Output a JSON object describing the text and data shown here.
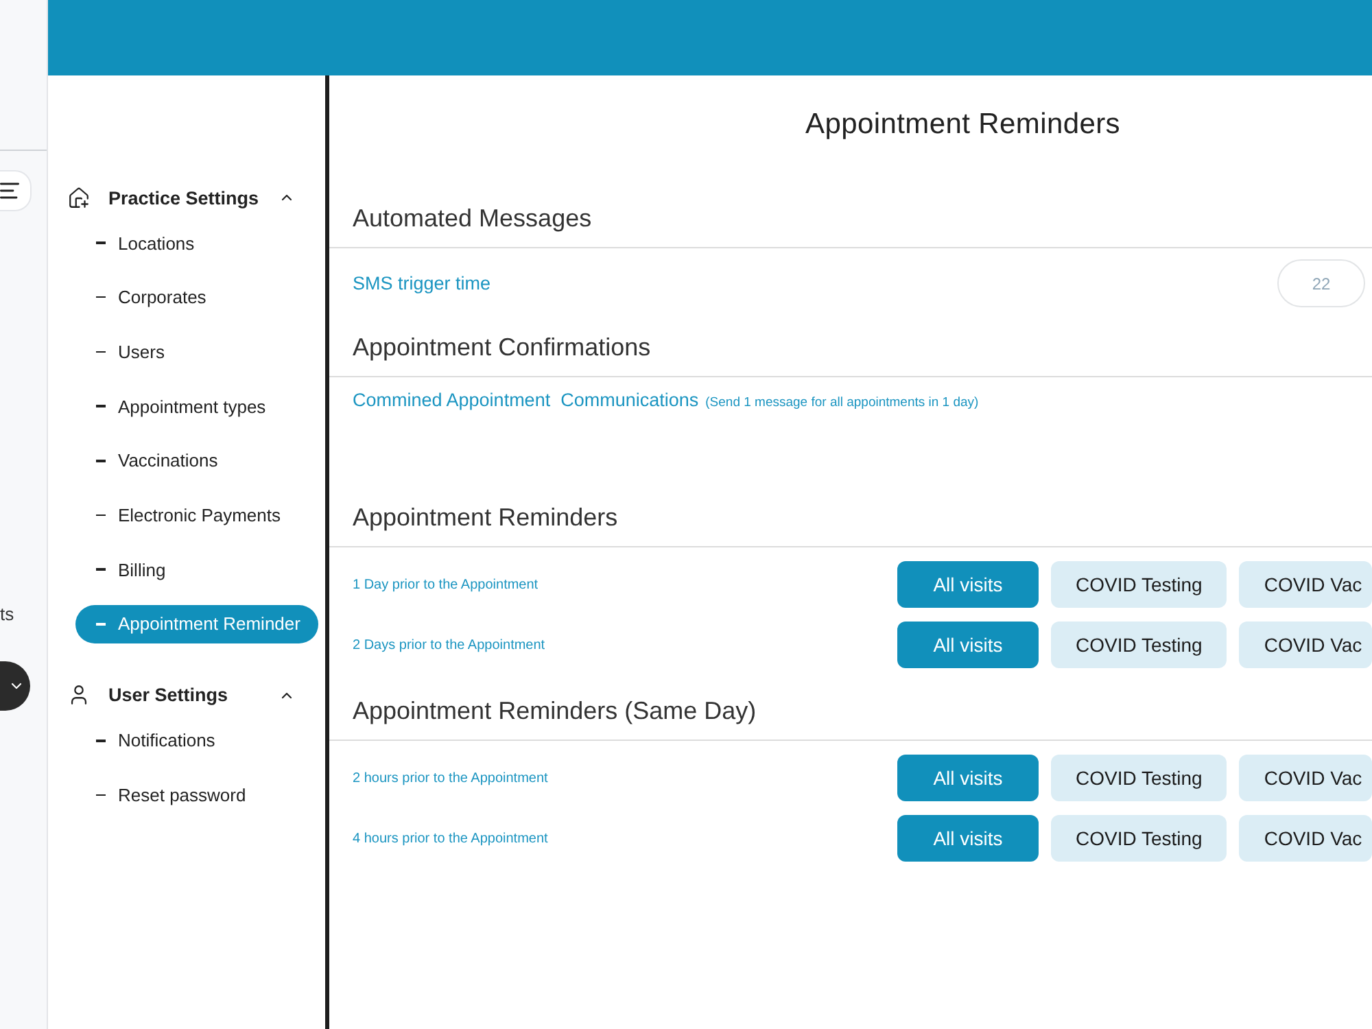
{
  "rail": {
    "label": "ts"
  },
  "sidebar": {
    "groups": [
      {
        "title": "Practice Settings",
        "expanded": true,
        "items": [
          {
            "label": "Locations",
            "selected": false
          },
          {
            "label": "Corporates",
            "selected": false
          },
          {
            "label": "Users",
            "selected": false
          },
          {
            "label": "Appointment types",
            "selected": false
          },
          {
            "label": "Vaccinations",
            "selected": false
          },
          {
            "label": "Electronic Payments",
            "selected": false
          },
          {
            "label": "Billing",
            "selected": false
          },
          {
            "label": "Appointment Reminder",
            "selected": true
          }
        ]
      },
      {
        "title": "User Settings",
        "expanded": true,
        "items": [
          {
            "label": "Notifications",
            "selected": false
          },
          {
            "label": "Reset password",
            "selected": false
          }
        ]
      }
    ]
  },
  "page_title": "Appointment Reminders",
  "sections": [
    {
      "title": "Automated Messages",
      "rows": [
        {
          "kind": "time",
          "label": "SMS trigger time",
          "value": "22"
        }
      ]
    },
    {
      "title": "Appointment Confirmations",
      "rows": [
        {
          "kind": "note",
          "label": "Commined Appointment  Communications",
          "note": "(Send 1 message for all appointments in 1 day)"
        }
      ]
    },
    {
      "title": "Appointment Reminders",
      "rows": [
        {
          "kind": "options",
          "label": "1 Day prior to the Appointment",
          "options": [
            {
              "label": "All visits",
              "selected": true
            },
            {
              "label": "COVID Testing",
              "selected": false
            },
            {
              "label": "COVID Vac",
              "selected": false
            }
          ]
        },
        {
          "kind": "options",
          "label": "2 Days prior to the Appointment",
          "options": [
            {
              "label": "All visits",
              "selected": true
            },
            {
              "label": "COVID Testing",
              "selected": false
            },
            {
              "label": "COVID Vac",
              "selected": false
            }
          ]
        }
      ]
    },
    {
      "title": "Appointment Reminders (Same Day)",
      "rows": [
        {
          "kind": "options",
          "label": "2 hours prior to the Appointment",
          "options": [
            {
              "label": "All visits",
              "selected": true
            },
            {
              "label": "COVID Testing",
              "selected": false
            },
            {
              "label": "COVID Vac",
              "selected": false
            }
          ]
        },
        {
          "kind": "options",
          "label": "4 hours prior to the Appointment",
          "options": [
            {
              "label": "All visits",
              "selected": true
            },
            {
              "label": "COVID Testing",
              "selected": false
            },
            {
              "label": "COVID Vac",
              "selected": false
            }
          ]
        }
      ]
    }
  ]
}
